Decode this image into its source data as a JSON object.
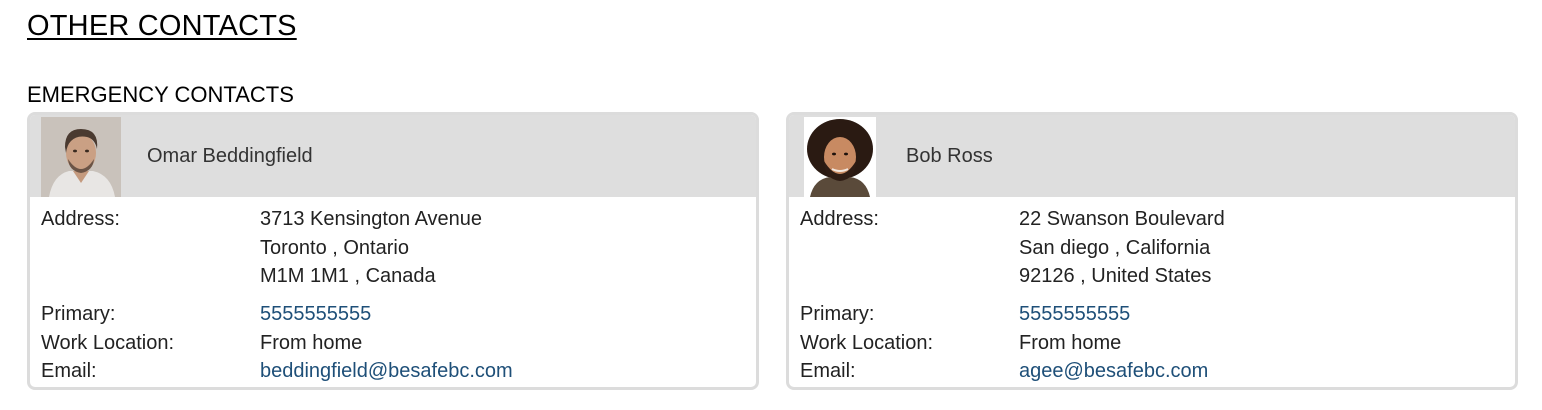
{
  "page": {
    "title": "OTHER CONTACTS",
    "section_title": "EMERGENCY CONTACTS"
  },
  "labels": {
    "address": "Address:",
    "primary": "Primary:",
    "work_location": "Work Location:",
    "email": "Email:"
  },
  "contacts": [
    {
      "name": "Omar Beddingfield",
      "address_line1": "3713 Kensington Avenue",
      "address_line2": "Toronto , Ontario",
      "address_line3": "M1M 1M1 , Canada",
      "primary": "5555555555",
      "work_location": "From home",
      "email": "beddingfield@besafebc.com"
    },
    {
      "name": "Bob Ross",
      "address_line1": "22 Swanson Boulevard",
      "address_line2": "San diego , California",
      "address_line3": "92126 , United States",
      "primary": "5555555555",
      "work_location": "From home",
      "email": "agee@besafebc.com"
    }
  ],
  "colors": {
    "link": "#1e4f78",
    "card_header_bg": "#dedede",
    "card_border": "#dcdcdc"
  }
}
